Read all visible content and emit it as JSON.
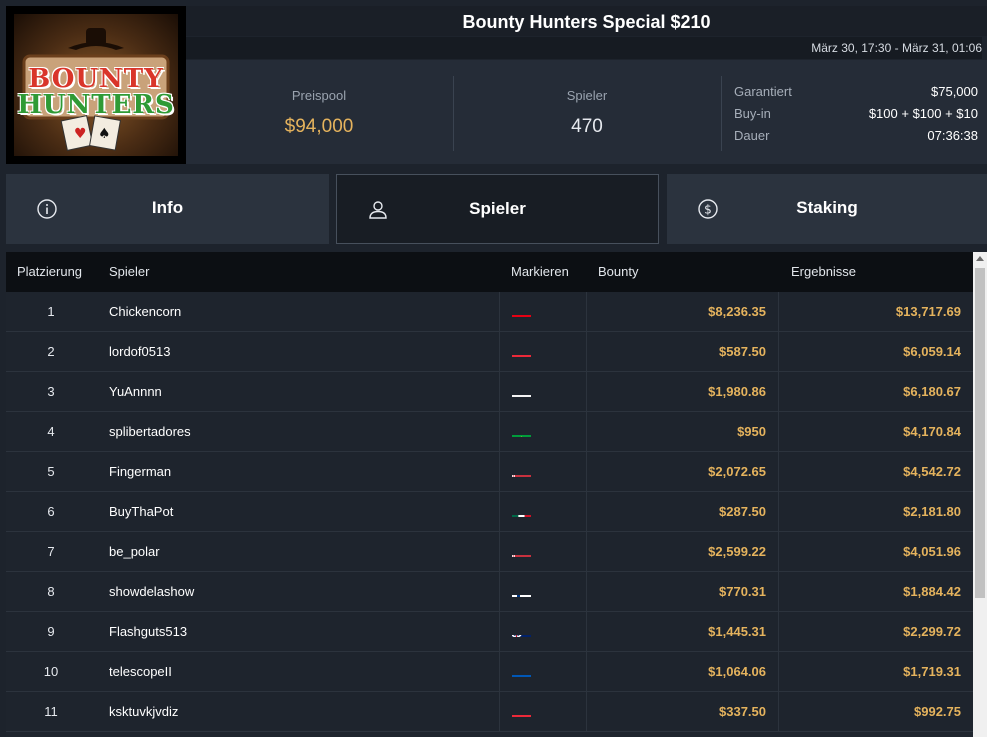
{
  "tournament": {
    "title": "Bounty Hunters Special $210",
    "date_range": "März 30, 17:30 - März 31, 01:06",
    "logo_text": [
      "BOUNTY",
      "HUNTERS"
    ]
  },
  "stats": {
    "prize_pool_label": "Preispool",
    "prize_pool_value": "$94,000",
    "players_label": "Spieler",
    "players_value": "470",
    "guaranteed_label": "Garantiert",
    "guaranteed_value": "$75,000",
    "buyin_label": "Buy-in",
    "buyin_value": "$100 + $100 + $10",
    "duration_label": "Dauer",
    "duration_value": "07:36:38"
  },
  "tabs": [
    {
      "label": "Info",
      "icon": "info-icon",
      "active": false
    },
    {
      "label": "Spieler",
      "icon": "user-icon",
      "active": true
    },
    {
      "label": "Staking",
      "icon": "dollar-coin-icon",
      "active": false
    }
  ],
  "table": {
    "headers": [
      "Platzierung",
      "Spieler",
      "Markieren",
      "Bounty",
      "Ergebnisse"
    ],
    "rows": [
      {
        "place": "1",
        "player": "Chickencorn",
        "flag": "tunisia",
        "bounty": "$8,236.35",
        "result": "$13,717.69"
      },
      {
        "place": "2",
        "player": "lordof0513",
        "flag": "austria",
        "bounty": "$587.50",
        "result": "$6,059.14"
      },
      {
        "place": "3",
        "player": "YuAnnnn",
        "flag": "unknown-emblem",
        "bounty": "$1,980.86",
        "result": "$6,180.67"
      },
      {
        "place": "4",
        "player": "splibertadores",
        "flag": "brazil",
        "bounty": "$950",
        "result": "$4,170.84"
      },
      {
        "place": "5",
        "player": "Fingerman",
        "flag": "belarus",
        "bounty": "$2,072.65",
        "result": "$4,542.72"
      },
      {
        "place": "6",
        "player": "BuyThaPot",
        "flag": "mexico",
        "bounty": "$287.50",
        "result": "$2,181.80"
      },
      {
        "place": "7",
        "player": "be_polar",
        "flag": "belarus",
        "bounty": "$2,599.22",
        "result": "$4,051.96"
      },
      {
        "place": "8",
        "player": "showdelashow",
        "flag": "finland",
        "bounty": "$770.31",
        "result": "$1,884.42"
      },
      {
        "place": "9",
        "player": "Flashguts513",
        "flag": "new-zealand",
        "bounty": "$1,445.31",
        "result": "$2,299.72"
      },
      {
        "place": "10",
        "player": "telescopeII",
        "flag": "ukraine",
        "bounty": "$1,064.06",
        "result": "$1,719.31"
      },
      {
        "place": "11",
        "player": "ksktuvkjvdiz",
        "flag": "austria",
        "bounty": "$337.50",
        "result": "$992.75"
      }
    ]
  },
  "colors": {
    "accent_gold": "#e5b35d",
    "background": "#1d232c",
    "header_bg": "#0c0f13"
  }
}
